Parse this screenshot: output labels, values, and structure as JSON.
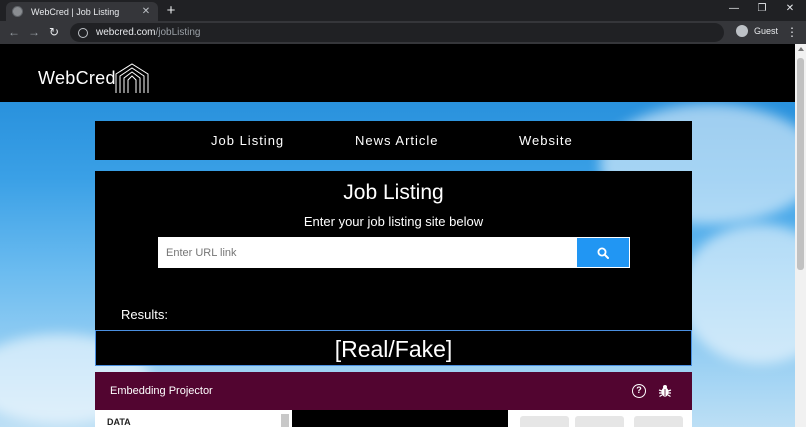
{
  "browser": {
    "tab_title": "WebCred | Job Listing",
    "tab_close": "✕",
    "new_tab": "+",
    "window_controls": {
      "minimize": "—",
      "maximize": "❐",
      "close": "✕"
    },
    "nav": {
      "back": "←",
      "forward": "→",
      "reload": "↻"
    },
    "url_host": "webcred.com",
    "url_path": "/jobListing",
    "profile_label": "Guest",
    "menu": "⋮"
  },
  "site": {
    "logo": "WebCred",
    "nav": [
      "Job Listing",
      "News Article",
      "Website"
    ]
  },
  "main": {
    "title": "Job Listing",
    "subtitle": "Enter your job listing site below",
    "search": {
      "placeholder": "Enter URL link",
      "value": ""
    },
    "results_label": "Results:",
    "result_value": "[Real/Fake]"
  },
  "projector": {
    "title": "Embedding Projector",
    "help": "?",
    "panel_label": "DATA"
  },
  "colors": {
    "accent": "#2196f3",
    "projector_bar": "#520530",
    "result_border": "#4a8fe0"
  },
  "icons": {
    "search": "search-icon",
    "help": "help-icon",
    "bug": "bug-icon",
    "logo": "building-logo-icon"
  }
}
